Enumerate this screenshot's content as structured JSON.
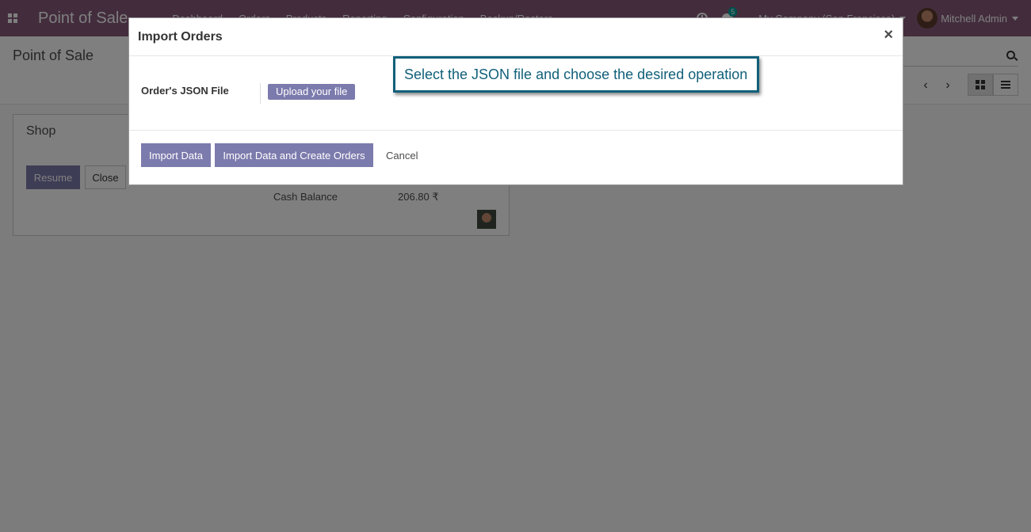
{
  "navbar": {
    "app_name": "Point of Sale",
    "menu": [
      "Dashboard",
      "Orders",
      "Products",
      "Reporting",
      "Configuration",
      "Backup/Restore"
    ],
    "chat_count": "5",
    "company": "My Company (San Francisco)",
    "user": "Mitchell Admin"
  },
  "control_panel": {
    "breadcrumb": "Point of Sale"
  },
  "card": {
    "title": "Shop",
    "resume_label": "Resume",
    "close_label": "Close",
    "cash_label": "Cash Balance",
    "cash_value": "206.80 ₹"
  },
  "modal": {
    "title": "Import Orders",
    "close_symbol": "×",
    "field_label": "Order's JSON File",
    "upload_label": "Upload your file",
    "callout": "Select the JSON file and choose the desired operation",
    "import_label": "Import Data",
    "import_create_label": "Import Data and Create Orders",
    "cancel_label": "Cancel"
  },
  "colors": {
    "navbar": "#875a7b",
    "primary_button": "#7c7bad",
    "callout": "#11607a",
    "badge": "#00a09d"
  }
}
